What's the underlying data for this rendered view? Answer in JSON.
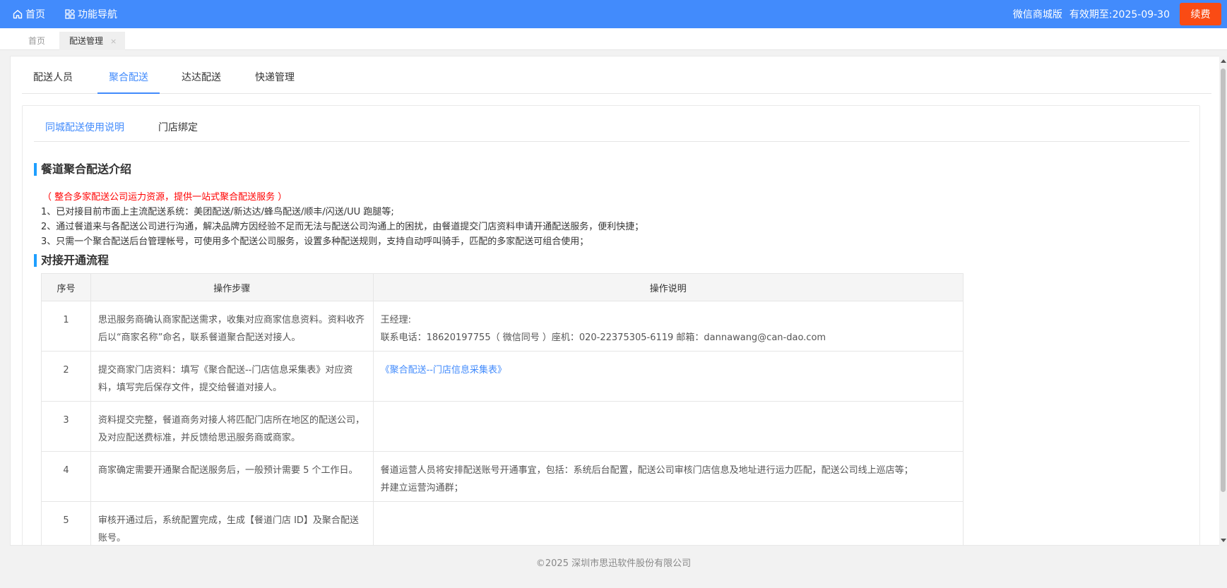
{
  "topbar": {
    "home_label": "首页",
    "nav_label": "功能导航",
    "edition": "微信商城版",
    "expiry": "有效期至:2025-09-30",
    "renew_label": "续费"
  },
  "page_tabs": {
    "home": "首页",
    "active": "配送管理",
    "close": "×"
  },
  "main_tabs": [
    "配送人员",
    "聚合配送",
    "达达配送",
    "快递管理"
  ],
  "sub_tabs": [
    "同城配送使用说明",
    "门店绑定"
  ],
  "intro": {
    "title": "餐道聚合配送介绍",
    "highlight": "（ 整合多家配送公司运力资源，提供一站式聚合配送服务 ）",
    "lines": [
      "1、已对接目前市面上主流配送系统：美团配送/新达达/蜂鸟配送/顺丰/闪送/UU 跑腿等;",
      "2、通过餐道来与各配送公司进行沟通，解决品牌方因经验不足而无法与配送公司沟通上的困扰，由餐道提交门店资料申请开通配送服务，便利快捷；",
      "3、只需一个聚合配送后台管理帐号，可使用多个配送公司服务，设置多种配送规则，支持自动呼叫骑手，匹配的多家配送可组合使用；"
    ]
  },
  "process": {
    "title": "对接开通流程",
    "headers": [
      "序号",
      "操作步骤",
      "操作说明"
    ],
    "rows": [
      {
        "num": "1",
        "step": "思迅服务商确认商家配送需求，收集对应商家信息资料。资料收齐后以“商家名称”命名，联系餐道聚合配送对接人。",
        "desc_line1": "王经理:",
        "desc_line2": "联系电话：18620197755（ 微信同号 ）座机：020-22375305-6119 邮箱：dannawang@can-dao.com",
        "link": ""
      },
      {
        "num": "2",
        "step": "提交商家门店资料：填写《聚合配送--门店信息采集表》对应资料，填写完后保存文件，提交给餐道对接人。",
        "desc_line1": "",
        "desc_line2": "",
        "link": "《聚合配送--门店信息采集表》"
      },
      {
        "num": "3",
        "step": "资料提交完整，餐道商务对接人将匹配门店所在地区的配送公司，及对应配送费标准，并反馈给思迅服务商或商家。",
        "desc_line1": "",
        "desc_line2": "",
        "link": ""
      },
      {
        "num": "4",
        "step": "商家确定需要开通聚合配送服务后，一般预计需要 5 个工作日。",
        "desc_line1": "餐道运营人员将安排配送账号开通事宜，包括：系统后台配置，配送公司审核门店信息及地址进行运力匹配，配送公司线上巡店等；",
        "desc_line2": "并建立运营沟通群；",
        "link": ""
      },
      {
        "num": "5",
        "step": "审核开通过后，系统配置完成，生成【餐道门店 ID】及聚合配送账号。",
        "desc_line1": "",
        "desc_line2": "",
        "link": ""
      }
    ]
  },
  "footer": "©2025 深圳市思迅软件股份有限公司",
  "colors": {
    "primary": "#428bfc",
    "renew": "#fa4b14",
    "highlight": "#ff0000"
  }
}
